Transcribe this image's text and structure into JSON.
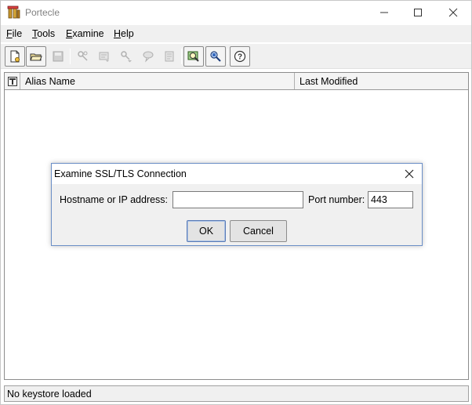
{
  "window": {
    "title": "Portecle"
  },
  "menubar": {
    "items": [
      {
        "mnemonic": "F",
        "rest": "ile"
      },
      {
        "mnemonic": "T",
        "rest": "ools"
      },
      {
        "mnemonic": "E",
        "rest": "xamine"
      },
      {
        "mnemonic": "H",
        "rest": "elp"
      }
    ]
  },
  "toolbar": {
    "icons": [
      "new-keystore-icon",
      "open-keystore-icon",
      "save-keystore-icon",
      "generate-keypair-icon",
      "import-trusted-cert-icon",
      "import-keypair-icon",
      "set-password-icon",
      "keystore-report-icon",
      "examine-certificate-icon",
      "examine-ssl-icon",
      "help-icon"
    ]
  },
  "table": {
    "columns": [
      "Alias Name",
      "Last Modified"
    ],
    "rows": []
  },
  "status": {
    "text": "No keystore loaded"
  },
  "dialog": {
    "title": "Examine SSL/TLS Connection",
    "hostname_label": "Hostname or IP address:",
    "hostname_value": "",
    "port_label": "Port number:",
    "port_value": "443",
    "ok_label": "OK",
    "cancel_label": "Cancel"
  }
}
